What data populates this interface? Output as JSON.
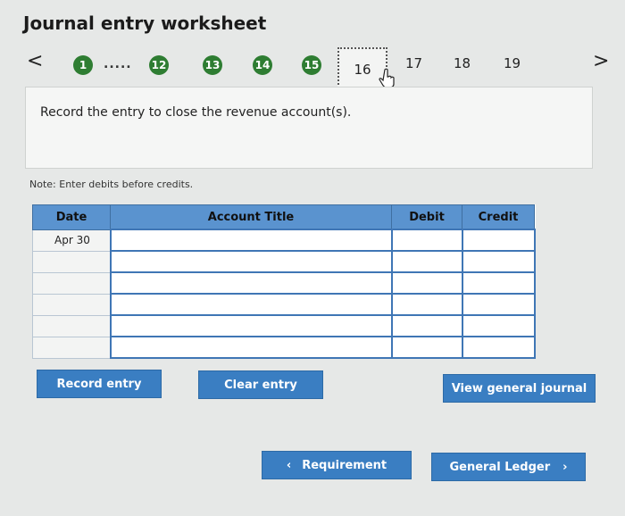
{
  "title": "Journal entry worksheet",
  "nav": {
    "prev_icon": "<",
    "next_icon": ">",
    "dots": ".....",
    "steps_completed": [
      "1",
      "12",
      "13",
      "14",
      "15"
    ],
    "current_step": "16",
    "steps_remaining": [
      "17",
      "18",
      "19"
    ]
  },
  "prompt": "Record the entry to close the revenue account(s).",
  "note": "Note: Enter debits before credits.",
  "table": {
    "headers": [
      "Date",
      "Account Title",
      "Debit",
      "Credit"
    ],
    "rows": [
      {
        "date": "Apr 30",
        "account": "",
        "debit": "",
        "credit": ""
      },
      {
        "date": "",
        "account": "",
        "debit": "",
        "credit": ""
      },
      {
        "date": "",
        "account": "",
        "debit": "",
        "credit": ""
      },
      {
        "date": "",
        "account": "",
        "debit": "",
        "credit": ""
      },
      {
        "date": "",
        "account": "",
        "debit": "",
        "credit": ""
      },
      {
        "date": "",
        "account": "",
        "debit": "",
        "credit": ""
      }
    ]
  },
  "buttons": {
    "record": "Record entry",
    "clear": "Clear entry",
    "view_journal": "View general journal",
    "requirement": "Requirement",
    "general_ledger": "General Ledger"
  },
  "colors": {
    "step_green": "#2e7d32",
    "button_blue": "#3a7ec2",
    "header_blue": "#5a93cf"
  }
}
